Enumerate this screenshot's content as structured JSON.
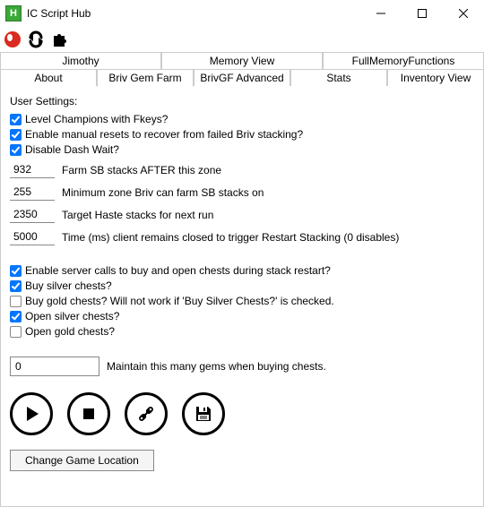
{
  "window": {
    "title": "IC Script Hub",
    "icon_letter": "H"
  },
  "tabs_row1": [
    {
      "label": "Jimothy"
    },
    {
      "label": "Memory View"
    },
    {
      "label": "FullMemoryFunctions"
    }
  ],
  "tabs_row2": [
    {
      "label": "About"
    },
    {
      "label": "Briv Gem Farm"
    },
    {
      "label": "BrivGF Advanced"
    },
    {
      "label": "Stats"
    },
    {
      "label": "Inventory View"
    }
  ],
  "settings_header": "User Settings:",
  "checks_a": [
    {
      "label": "Level Champions with Fkeys?",
      "checked": true
    },
    {
      "label": "Enable manual resets to recover from failed Briv stacking?",
      "checked": true
    },
    {
      "label": "Disable Dash Wait?",
      "checked": true
    }
  ],
  "inputs": [
    {
      "value": "932",
      "label": "Farm SB stacks AFTER this zone"
    },
    {
      "value": "255",
      "label": "Minimum zone Briv can farm SB stacks on"
    },
    {
      "value": "2350",
      "label": "Target Haste stacks for next run"
    },
    {
      "value": "5000",
      "label": "Time (ms) client remains closed to trigger Restart Stacking (0 disables)"
    }
  ],
  "checks_b": [
    {
      "label": "Enable server calls to buy and open chests during stack restart?",
      "checked": true
    },
    {
      "label": "Buy silver chests?",
      "checked": true
    },
    {
      "label": "Buy gold chests? Will not work if 'Buy Silver Chests?' is checked.",
      "checked": false
    },
    {
      "label": "Open silver chests?",
      "checked": true
    },
    {
      "label": "Open gold chests?",
      "checked": false
    }
  ],
  "gems": {
    "value": "0",
    "label": "Maintain this many gems when buying chests."
  },
  "change_location_btn": "Change Game Location"
}
